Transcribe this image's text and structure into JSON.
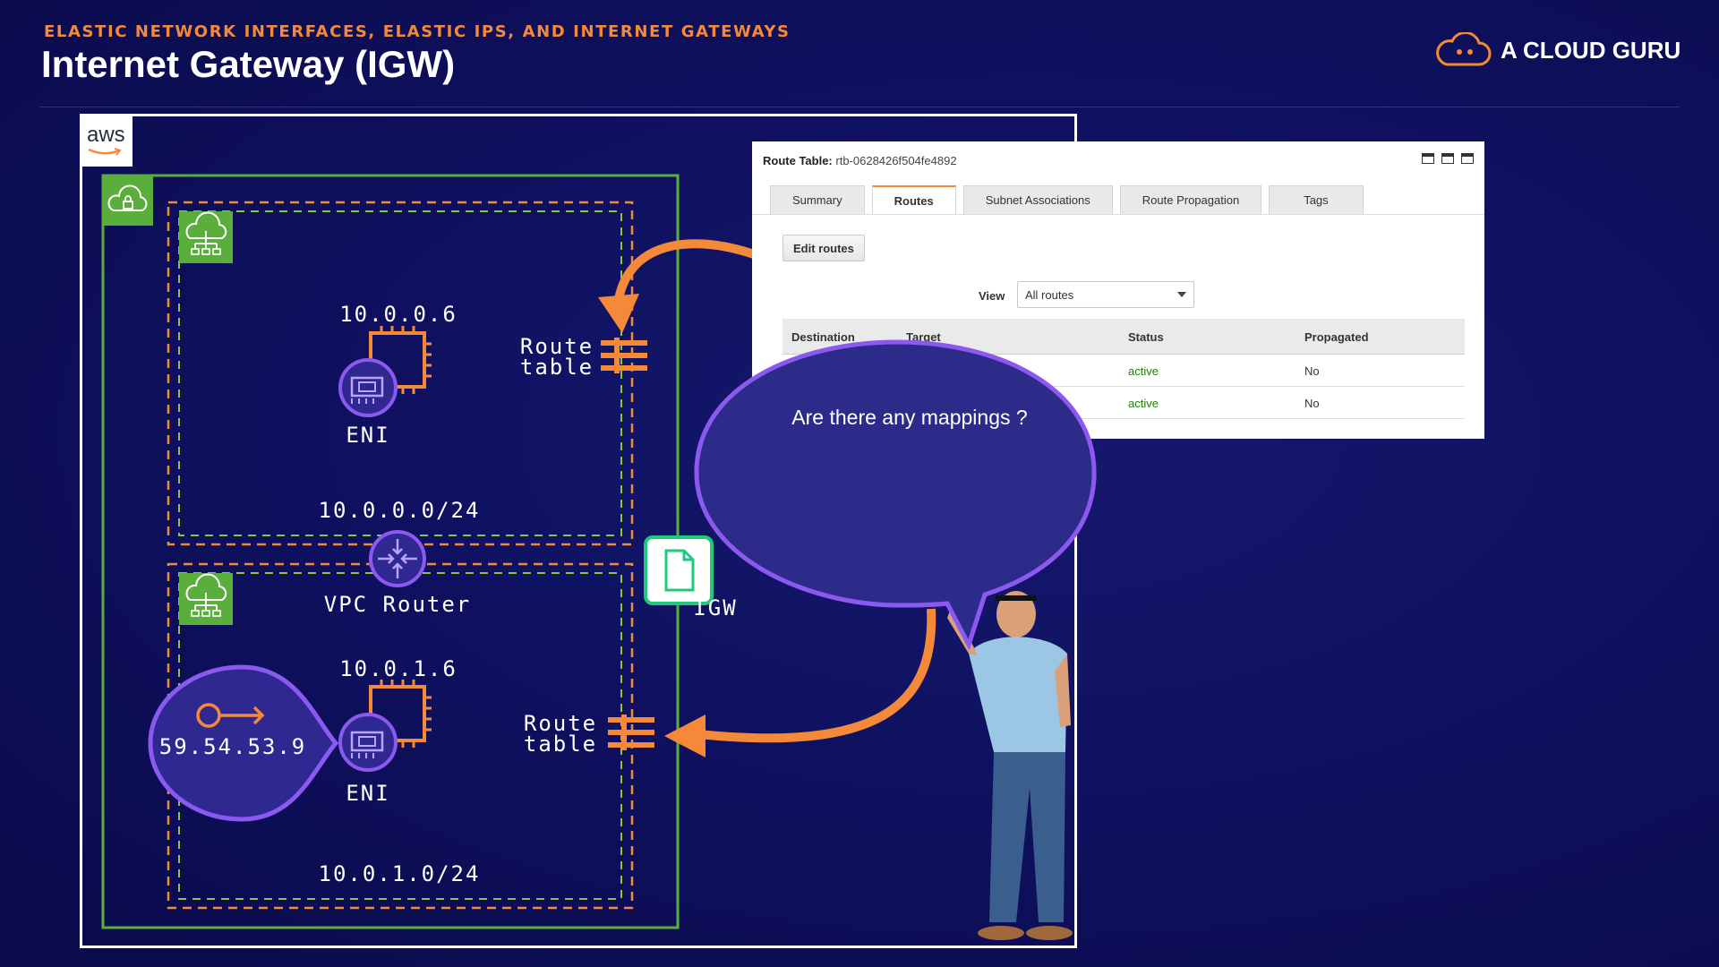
{
  "header": {
    "kicker": "ELASTIC NETWORK INTERFACES, ELASTIC IPS, AND INTERNET GATEWAYS",
    "title": "Internet Gateway (IGW)",
    "brand": "A CLOUD GURU"
  },
  "diagram": {
    "aws_logo": "aws",
    "subnet1": {
      "ip": "10.0.0.6",
      "eni_label": "ENI",
      "cidr": "10.0.0.0/24",
      "route_table": [
        "Route",
        "table"
      ]
    },
    "vpc_router": "VPC Router",
    "subnet2": {
      "ip": "10.0.1.6",
      "eni_label": "ENI",
      "cidr": "10.0.1.0/24",
      "route_table": [
        "Route",
        "table"
      ]
    },
    "elastic_ip": "59.54.53.9",
    "igw_label": "IGW",
    "speech_bubble": "Are there any mappings ?",
    "colors": {
      "accent": "#f5893a",
      "subnet_green": "#5aaf3c",
      "eni_purple": "#8c59f0",
      "bubble_fill": "#2d2b8a"
    }
  },
  "route_table_window": {
    "title_label": "Route Table:",
    "title_id": "rtb-0628426f504fe4892",
    "tabs": [
      {
        "label": "Summary",
        "active": false
      },
      {
        "label": "Routes",
        "active": true
      },
      {
        "label": "Subnet Associations",
        "active": false
      },
      {
        "label": "Route Propagation",
        "active": false
      },
      {
        "label": "Tags",
        "active": false
      }
    ],
    "edit_button": "Edit routes",
    "view_label": "View",
    "view_value": "All routes",
    "columns": [
      "Destination",
      "Target",
      "Status",
      "Propagated"
    ],
    "rows": [
      {
        "status": "active",
        "propagated": "No"
      },
      {
        "status": "active",
        "propagated": "No"
      }
    ]
  }
}
